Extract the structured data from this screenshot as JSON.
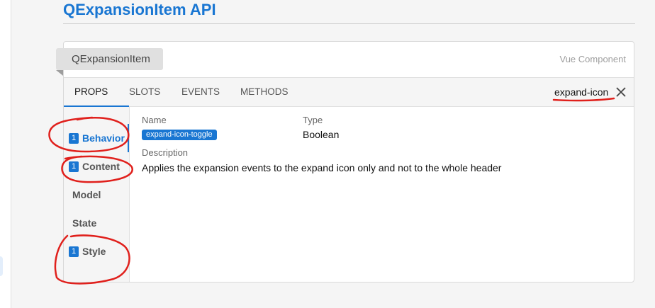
{
  "page": {
    "title": "QExpansionItem API"
  },
  "component": {
    "name": "QExpansionItem",
    "kind": "Vue Component"
  },
  "tabs": [
    {
      "label": "PROPS",
      "active": true
    },
    {
      "label": "SLOTS",
      "active": false
    },
    {
      "label": "EVENTS",
      "active": false
    },
    {
      "label": "METHODS",
      "active": false
    }
  ],
  "filter": {
    "value": "expand-icon",
    "clear_icon": "close-icon"
  },
  "categories": [
    {
      "label": "Behavior",
      "count": "1",
      "active": true
    },
    {
      "label": "Content",
      "count": "1",
      "active": false
    },
    {
      "label": "Model",
      "count": "",
      "active": false
    },
    {
      "label": "State",
      "count": "",
      "active": false
    },
    {
      "label": "Style",
      "count": "1",
      "active": false
    }
  ],
  "prop": {
    "name_label": "Name",
    "name": "expand-icon-toggle",
    "type_label": "Type",
    "type": "Boolean",
    "description_label": "Description",
    "description": "Applies the expansion events to the expand icon only and not to the whole header"
  },
  "colors": {
    "accent": "#1976d2",
    "annotation": "#e0201c"
  }
}
